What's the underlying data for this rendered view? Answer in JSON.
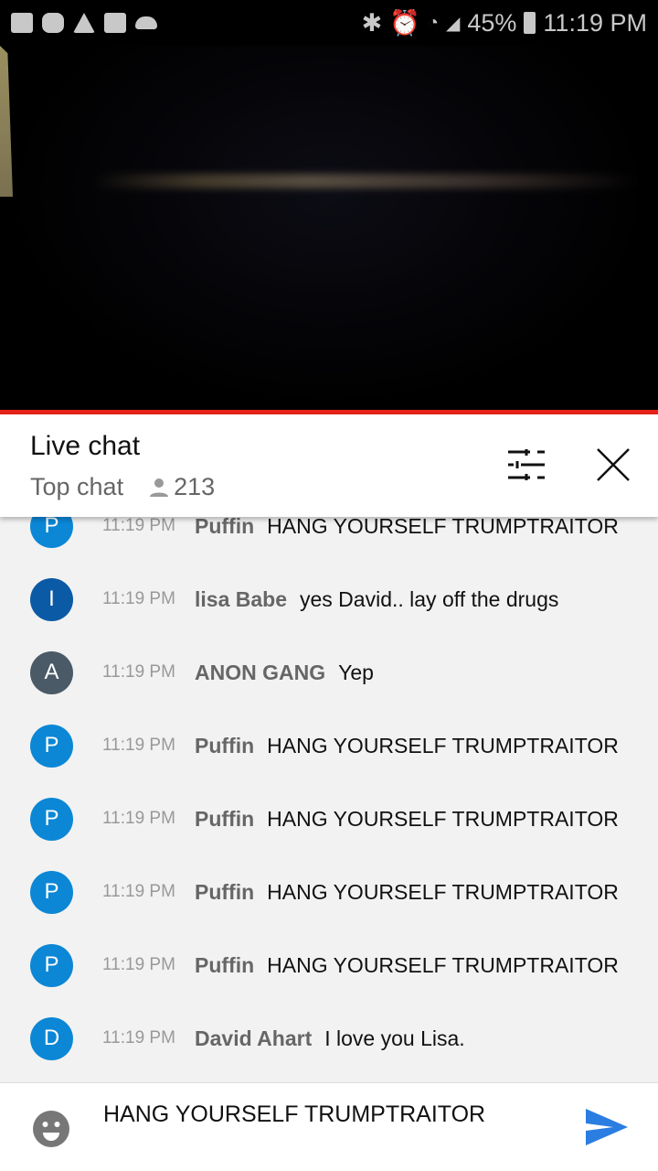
{
  "status_bar": {
    "battery": "45%",
    "time": "11:19 PM",
    "left_icons": [
      "folder-icon",
      "m-app-icon",
      "warning-icon",
      "image-icon",
      "cloud-icon"
    ],
    "right_icons": [
      "bluetooth-icon",
      "alarm-icon",
      "wifi-icon",
      "signal-icon",
      "battery-icon"
    ]
  },
  "header": {
    "title": "Live chat",
    "mode": "Top chat",
    "viewers": "213"
  },
  "messages": [
    {
      "initial": "P",
      "color": "#0b87d6",
      "time": "11:19 PM",
      "author": "Puffin",
      "text": "HANG YOURSELF TRUMPTRAITOR"
    },
    {
      "initial": "I",
      "color": "#0b5aa6",
      "time": "11:19 PM",
      "author": "lisa Babe",
      "text": "yes David.. lay off the drugs"
    },
    {
      "initial": "A",
      "color": "#4a5a66",
      "time": "11:19 PM",
      "author": "ANON GANG",
      "text": "Yep"
    },
    {
      "initial": "P",
      "color": "#0b87d6",
      "time": "11:19 PM",
      "author": "Puffin",
      "text": "HANG YOURSELF TRUMPTRAITOR"
    },
    {
      "initial": "P",
      "color": "#0b87d6",
      "time": "11:19 PM",
      "author": "Puffin",
      "text": "HANG YOURSELF TRUMPTRAITOR"
    },
    {
      "initial": "P",
      "color": "#0b87d6",
      "time": "11:19 PM",
      "author": "Puffin",
      "text": "HANG YOURSELF TRUMPTRAITOR"
    },
    {
      "initial": "P",
      "color": "#0b87d6",
      "time": "11:19 PM",
      "author": "Puffin",
      "text": "HANG YOURSELF TRUMPTRAITOR"
    },
    {
      "initial": "D",
      "color": "#0b87d6",
      "time": "11:19 PM",
      "author": "David Ahart",
      "text": "I love you Lisa."
    }
  ],
  "input": {
    "value": "HANG YOURSELF TRUMPTRAITOR"
  },
  "colors": {
    "accent": "#e62117",
    "send": "#2a7de1"
  }
}
